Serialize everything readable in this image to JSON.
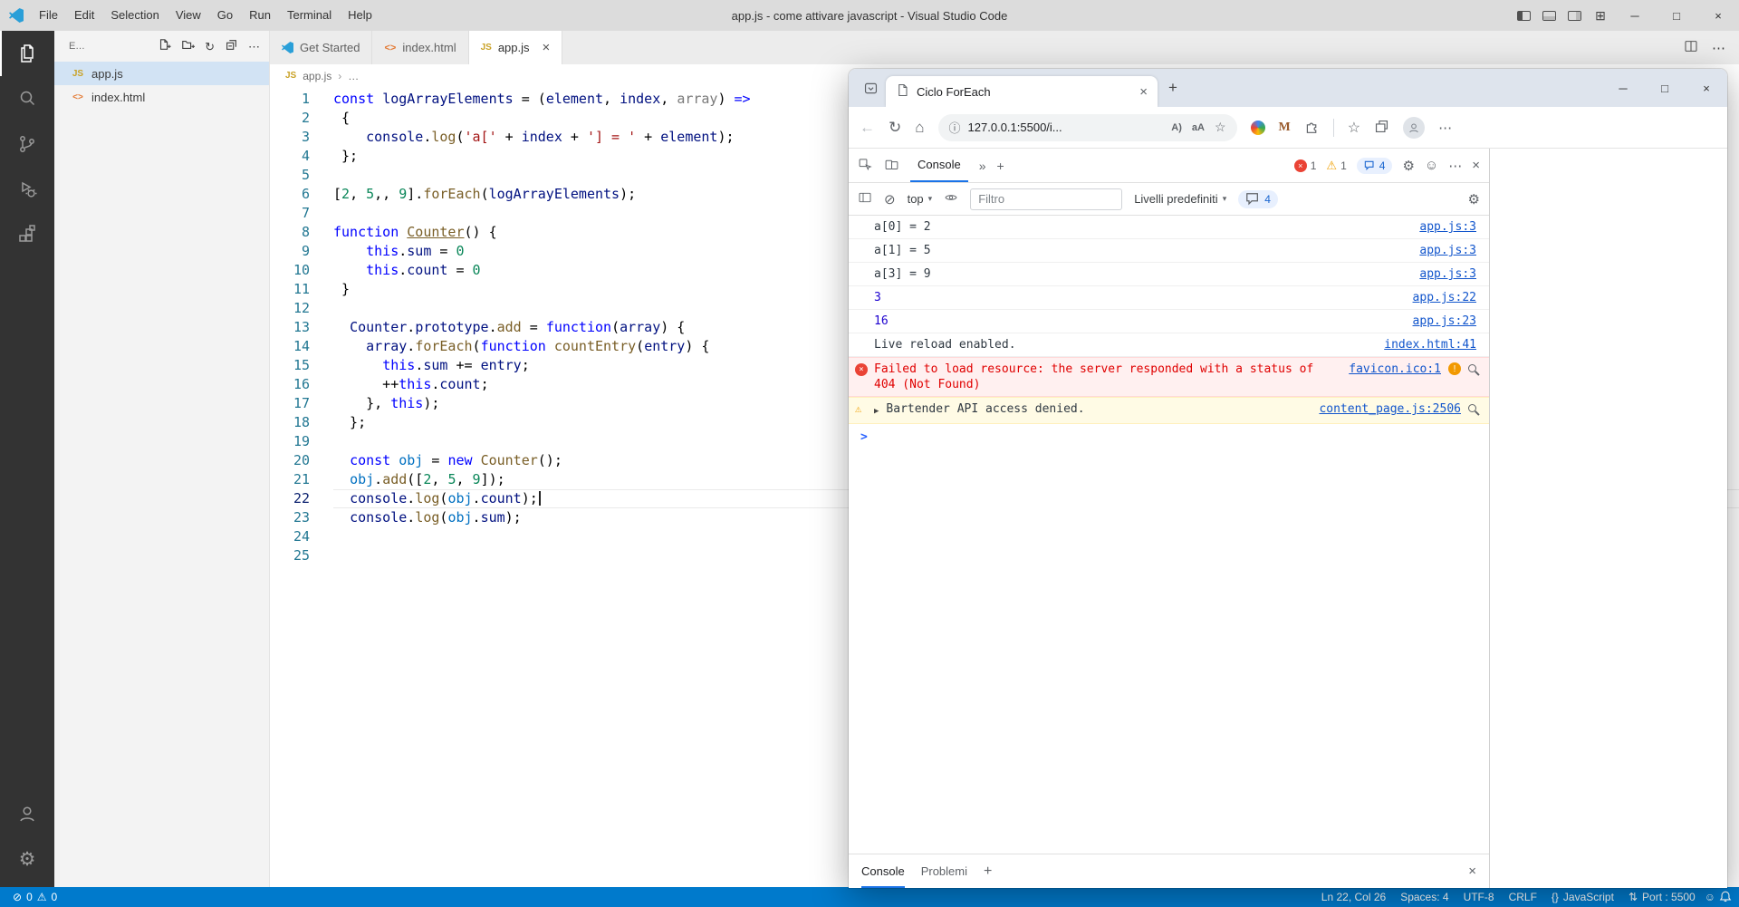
{
  "icons": {
    "close": "×",
    "minimize": "─",
    "maximize": "□",
    "plus": "+",
    "more": "⋯",
    "chevron_down": "▾",
    "breadcrumb_sep": "›",
    "breadcrumb_more": "…",
    "double_chevron": "»",
    "back": "←",
    "refresh": "↻",
    "home": "⌂",
    "info": "ⓘ",
    "block": "⊘",
    "warning": "⚠",
    "gear": "⚙",
    "caret_right": "▶",
    "star": "☆",
    "read_aloud": "A)",
    "translate": "aA",
    "smiley": "☺",
    "error_x": "×",
    "bang": "!",
    "grid": "⊞",
    "prompt": ">",
    "ports": "⇅",
    "brace_pair": "{}"
  },
  "vscode": {
    "titlebar": {
      "title": "app.js - come attivare javascript - Visual Studio Code",
      "menus": [
        "File",
        "Edit",
        "Selection",
        "View",
        "Go",
        "Run",
        "Terminal",
        "Help"
      ]
    },
    "explorer": {
      "header_label": "E...",
      "files": [
        {
          "name": "app.js",
          "badge": "JS",
          "badge_color": "#c9a227",
          "active": true
        },
        {
          "name": "index.html",
          "badge": "<>",
          "badge_color": "#e37933",
          "active": false
        }
      ]
    },
    "tabs": [
      {
        "label": "Get Started",
        "icon": "vscode",
        "active": false
      },
      {
        "label": "index.html",
        "icon": "html",
        "active": false
      },
      {
        "label": "app.js",
        "icon": "js",
        "active": true
      }
    ],
    "breadcrumb": {
      "file": "app.js"
    },
    "editor": {
      "current_line": 22,
      "lines": [
        [
          [
            "kw",
            "const"
          ],
          [
            "pun",
            " "
          ],
          [
            "var",
            "logArrayElements"
          ],
          [
            "pun",
            " = ("
          ],
          [
            "var",
            "element"
          ],
          [
            "pun",
            ", "
          ],
          [
            "var",
            "index"
          ],
          [
            "pun",
            ", "
          ],
          [
            "dim",
            "array"
          ],
          [
            "pun",
            ") "
          ],
          [
            "kw",
            "=>"
          ]
        ],
        [
          [
            "pun",
            " {"
          ]
        ],
        [
          [
            "pun",
            "    "
          ],
          [
            "var",
            "console"
          ],
          [
            "pun",
            "."
          ],
          [
            "fn",
            "log"
          ],
          [
            "pun",
            "("
          ],
          [
            "str",
            "'a['"
          ],
          [
            "pun",
            " + "
          ],
          [
            "var",
            "index"
          ],
          [
            "pun",
            " + "
          ],
          [
            "str",
            "'] = '"
          ],
          [
            "pun",
            " + "
          ],
          [
            "var",
            "element"
          ],
          [
            "pun",
            ");"
          ]
        ],
        [
          [
            "pun",
            " };"
          ]
        ],
        [],
        [
          [
            "pun",
            "["
          ],
          [
            "num",
            "2"
          ],
          [
            "pun",
            ", "
          ],
          [
            "num",
            "5"
          ],
          [
            "pun",
            ",, "
          ],
          [
            "num",
            "9"
          ],
          [
            "pun",
            "]."
          ],
          [
            "fn",
            "forEach"
          ],
          [
            "pun",
            "("
          ],
          [
            "var",
            "logArrayElements"
          ],
          [
            "pun",
            ");"
          ]
        ],
        [],
        [
          [
            "kw",
            "function"
          ],
          [
            "pun",
            " "
          ],
          [
            "fn u",
            "Counter"
          ],
          [
            "pun",
            "() {"
          ]
        ],
        [
          [
            "pun",
            "    "
          ],
          [
            "kw",
            "this"
          ],
          [
            "pun",
            "."
          ],
          [
            "var",
            "sum"
          ],
          [
            "pun",
            " = "
          ],
          [
            "num",
            "0"
          ]
        ],
        [
          [
            "pun",
            "    "
          ],
          [
            "kw",
            "this"
          ],
          [
            "pun",
            "."
          ],
          [
            "var",
            "count"
          ],
          [
            "pun",
            " = "
          ],
          [
            "num",
            "0"
          ]
        ],
        [
          [
            "pun",
            " }"
          ]
        ],
        [],
        [
          [
            "pun",
            "  "
          ],
          [
            "var",
            "Counter"
          ],
          [
            "pun",
            "."
          ],
          [
            "var",
            "prototype"
          ],
          [
            "pun",
            "."
          ],
          [
            "fn",
            "add"
          ],
          [
            "pun",
            " = "
          ],
          [
            "kw",
            "function"
          ],
          [
            "pun",
            "("
          ],
          [
            "var",
            "array"
          ],
          [
            "pun",
            ") {"
          ]
        ],
        [
          [
            "pun",
            "    "
          ],
          [
            "var",
            "array"
          ],
          [
            "pun",
            "."
          ],
          [
            "fn",
            "forEach"
          ],
          [
            "pun",
            "("
          ],
          [
            "kw",
            "function"
          ],
          [
            "pun",
            " "
          ],
          [
            "fn",
            "countEntry"
          ],
          [
            "pun",
            "("
          ],
          [
            "var",
            "entry"
          ],
          [
            "pun",
            ") {"
          ]
        ],
        [
          [
            "pun",
            "      "
          ],
          [
            "kw",
            "this"
          ],
          [
            "pun",
            "."
          ],
          [
            "var",
            "sum"
          ],
          [
            "pun",
            " += "
          ],
          [
            "var",
            "entry"
          ],
          [
            "pun",
            ";"
          ]
        ],
        [
          [
            "pun",
            "      ++"
          ],
          [
            "kw",
            "this"
          ],
          [
            "pun",
            "."
          ],
          [
            "var",
            "count"
          ],
          [
            "pun",
            ";"
          ]
        ],
        [
          [
            "pun",
            "    }, "
          ],
          [
            "kw",
            "this"
          ],
          [
            "pun",
            ");"
          ]
        ],
        [
          [
            "pun",
            "  };"
          ]
        ],
        [],
        [
          [
            "pun",
            "  "
          ],
          [
            "kw",
            "const"
          ],
          [
            "pun",
            " "
          ],
          [
            "cvar",
            "obj"
          ],
          [
            "pun",
            " = "
          ],
          [
            "kw",
            "new"
          ],
          [
            "pun",
            " "
          ],
          [
            "fn",
            "Counter"
          ],
          [
            "pun",
            "();"
          ]
        ],
        [
          [
            "pun",
            "  "
          ],
          [
            "cvar",
            "obj"
          ],
          [
            "pun",
            "."
          ],
          [
            "fn",
            "add"
          ],
          [
            "pun",
            "(["
          ],
          [
            "num",
            "2"
          ],
          [
            "pun",
            ", "
          ],
          [
            "num",
            "5"
          ],
          [
            "pun",
            ", "
          ],
          [
            "num",
            "9"
          ],
          [
            "pun",
            "]);"
          ]
        ],
        [
          [
            "pun",
            "  "
          ],
          [
            "var",
            "console"
          ],
          [
            "pun",
            "."
          ],
          [
            "fn",
            "log"
          ],
          [
            "pun",
            "("
          ],
          [
            "cvar",
            "obj"
          ],
          [
            "pun",
            "."
          ],
          [
            "var",
            "count"
          ],
          [
            "pun",
            ");"
          ]
        ],
        [
          [
            "pun",
            "  "
          ],
          [
            "var",
            "console"
          ],
          [
            "pun",
            "."
          ],
          [
            "fn",
            "log"
          ],
          [
            "pun",
            "("
          ],
          [
            "cvar",
            "obj"
          ],
          [
            "pun",
            "."
          ],
          [
            "var",
            "sum"
          ],
          [
            "pun",
            ");"
          ]
        ],
        [],
        []
      ]
    },
    "status_bar": {
      "errors": "0",
      "warnings": "0",
      "right_items": [
        {
          "name": "cursor-position",
          "label": "Ln 22, Col 26"
        },
        {
          "name": "indentation",
          "label": "Spaces: 4"
        },
        {
          "name": "encoding",
          "label": "UTF-8"
        },
        {
          "name": "eol",
          "label": "CRLF"
        },
        {
          "name": "language-mode",
          "label": "JavaScript",
          "icon": "{}"
        },
        {
          "name": "port-forward",
          "label": "Port : 5500",
          "icon": "⇅"
        }
      ]
    }
  },
  "browser": {
    "tab_title": "Ciclo ForEach",
    "url": "127.0.0.1:5500/i...",
    "devtools": {
      "panel_tab": "Console",
      "badges": {
        "errors": "1",
        "warnings": "1",
        "messages": "4"
      },
      "toolbar": {
        "context": "top",
        "filter_placeholder": "Filtro",
        "levels": "Livelli predefiniti",
        "messages_count": "4"
      },
      "messages": [
        {
          "type": "log",
          "text": "a[0] = 2",
          "source": "app.js:3"
        },
        {
          "type": "log",
          "text": "a[1] = 5",
          "source": "app.js:3"
        },
        {
          "type": "log",
          "text": "a[3] = 9",
          "source": "app.js:3"
        },
        {
          "type": "num",
          "text": "3",
          "source": "app.js:22"
        },
        {
          "type": "num",
          "text": "16",
          "source": "app.js:23"
        },
        {
          "type": "log",
          "text": "Live reload enabled.",
          "source": "index.html:41"
        },
        {
          "type": "error",
          "text": "Failed to load resource: the server responded with a status of 404 (Not Found)",
          "source": "favicon.ico:1"
        },
        {
          "type": "warning",
          "text": "Bartender API access denied.",
          "source": "content_page.js:2506"
        }
      ],
      "drawer_tabs": [
        {
          "label": "Console",
          "active": true
        },
        {
          "label": "Problemi",
          "active": false
        }
      ]
    }
  }
}
